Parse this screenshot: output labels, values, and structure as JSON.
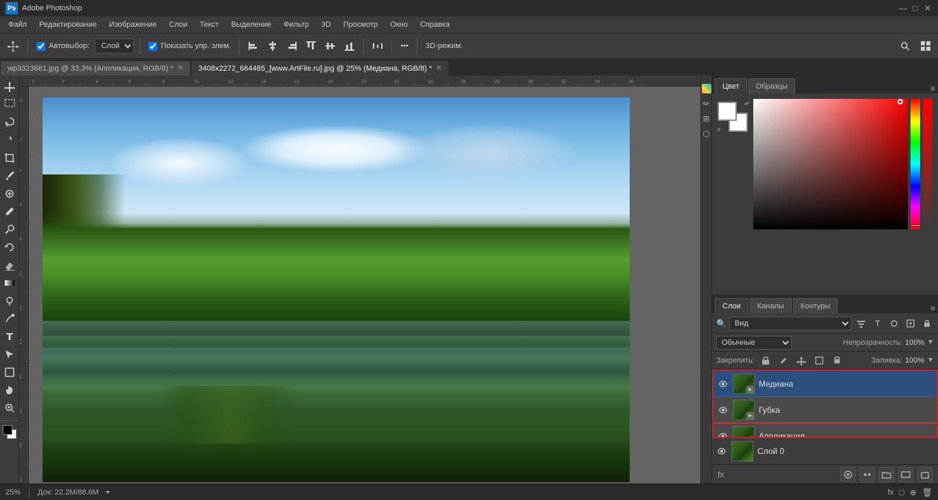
{
  "app": {
    "title": "Adobe Photoshop",
    "icon": "Ps"
  },
  "titlebar": {
    "controls": {
      "minimize": "—",
      "maximize": "□",
      "close": "✕"
    }
  },
  "menubar": {
    "items": [
      "Файл",
      "Редактирование",
      "Изображение",
      "Слои",
      "Текст",
      "Выделение",
      "Фильтр",
      "3D",
      "Просмотр",
      "Окно",
      "Справка"
    ]
  },
  "toolbar": {
    "auto_select_label": "Автовыбор:",
    "layer_select": "Слой",
    "show_controls": "Показать упр. элем.",
    "three_d_mode": "3D-режим:",
    "more_btn": "•••"
  },
  "tabs": [
    {
      "id": "tab1",
      "label": "wp3323661.jpg @ 33,3% (Аппликация, RGB/8) *",
      "active": false
    },
    {
      "id": "tab2",
      "label": "3408x2272_664485_[www.ArtFile.ru].jpg @ 25% (Медиана, RGB/8) *",
      "active": true
    }
  ],
  "canvas": {
    "zoom": "25%",
    "doc_size": "Док: 22.2M/88.6M"
  },
  "color_panel": {
    "tabs": [
      "Цвет",
      "Образцы"
    ],
    "active_tab": "Цвет"
  },
  "layers_panel": {
    "tabs": [
      "Слои",
      "Каналы",
      "Контуры"
    ],
    "active_tab": "Слои",
    "filter_label": "Вид",
    "blend_mode": "Обычные",
    "opacity_label": "Непрозрачность:",
    "opacity_value": "100%",
    "lock_label": "Закрепить:",
    "fill_label": "Заливка:",
    "fill_value": "100%",
    "layers": [
      {
        "id": "layer-mediana",
        "name": "Медиана",
        "visible": true,
        "selected": true,
        "highlighted": true
      },
      {
        "id": "layer-gubka",
        "name": "Губка",
        "visible": true,
        "selected": false,
        "highlighted": true
      },
      {
        "id": "layer-applikacia",
        "name": "Аппликация",
        "visible": true,
        "selected": false,
        "highlighted": true
      },
      {
        "id": "layer-sloy0",
        "name": "Слой 0",
        "visible": true,
        "selected": false,
        "highlighted": false
      }
    ]
  },
  "statusbar": {
    "zoom": "25%",
    "doc_size": "Док: 22.2M/88.6M"
  },
  "icons": {
    "eye": "👁",
    "move": "✥",
    "zoom": "🔍",
    "layers_fx": "fx"
  }
}
